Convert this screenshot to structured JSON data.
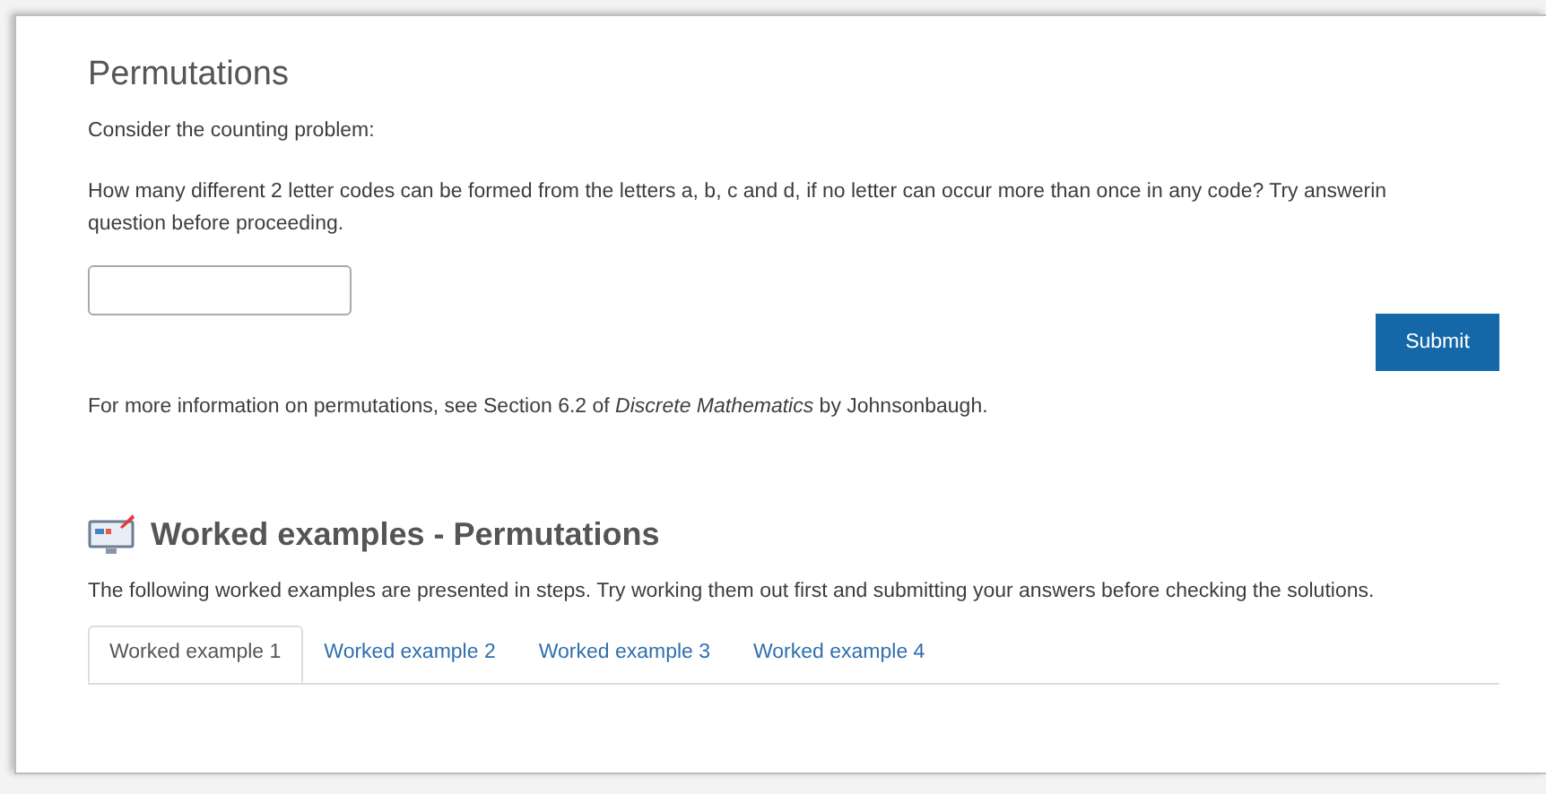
{
  "section_title": "Permutations",
  "intro": "Consider the counting problem:",
  "question_lines": [
    "How many different 2 letter codes can be formed from the letters a, b, c and d, if no letter can occur more than once in any code? Try answerin",
    "question before proceeding."
  ],
  "submit": "Submit",
  "more_info": "For more information on permutations, see Section 6.2 of *Discrete Mathematics* by Johnsonbaugh.",
  "worked": {
    "title": "Worked examples - Permutations",
    "description": "The following worked examples are presented in steps. Try working them out first and submitting your answers before checking the solutions.",
    "tabs": [
      {
        "label": "Worked example 1",
        "selected": true
      },
      {
        "label": "Worked example 2",
        "selected": false
      },
      {
        "label": "Worked example 3",
        "selected": false
      },
      {
        "label": "Worked example 4",
        "selected": false
      }
    ]
  }
}
